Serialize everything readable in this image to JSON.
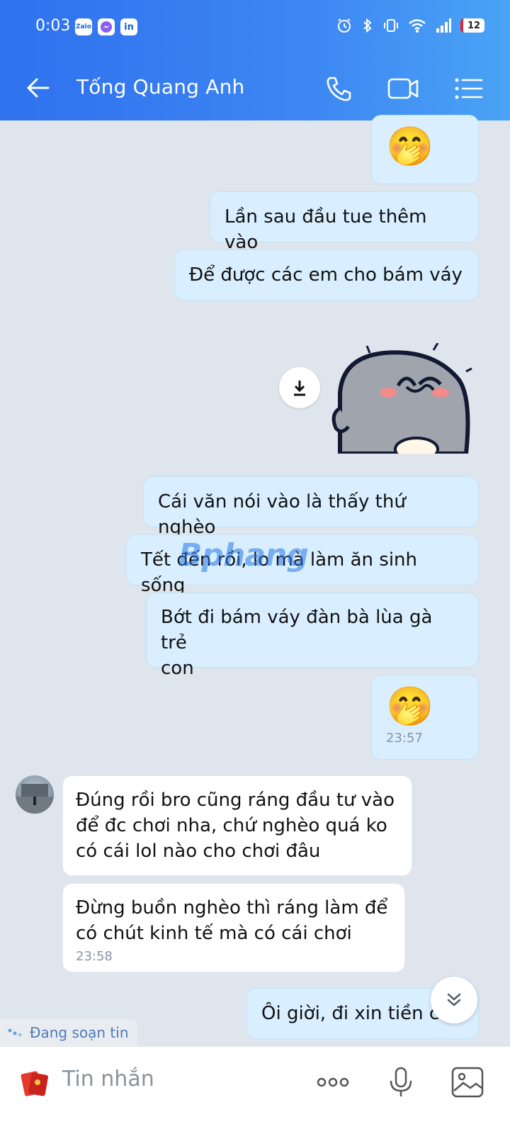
{
  "status_bar": {
    "time": "0:03",
    "battery": "12"
  },
  "header": {
    "contact_name": "Tống Quang Anh"
  },
  "messages": {
    "m1": "Lần sau đầu tue thêm vào",
    "m2": "Để được các em cho bám váy",
    "m3": "Cái văn nói vào là thấy thứ nghèo",
    "m4": "Tết đến rồi, lo mà làm ăn sinh sống",
    "m5": "Bớt đi bám váy đàn bà lùa gà trẻ\ncon",
    "m6_time": "23:57",
    "t1": "Đúng rồi bro cũng ráng đầu tư vào\nđể đc chơi nha, chứ nghèo quá ko\ncó cái lol nào cho chơi đâu",
    "t2": "Đừng buồn nghèo thì ráng làm để\ncó chút kinh tế mà có cái chơi",
    "t2_time": "23:58",
    "m7": "Ôi giời, đi xin tiền c"
  },
  "emoji": {
    "shy": "🤭"
  },
  "watermark": "Bphang",
  "typing_indicator": "Đang soạn tin",
  "composer": {
    "placeholder": "Tin nhắn"
  },
  "colors": {
    "header_start": "#2f71ee",
    "header_end": "#4aa3f4",
    "my_bubble": "#d9efff",
    "their_bubble": "#ffffff",
    "background": "#dfe5ec"
  }
}
